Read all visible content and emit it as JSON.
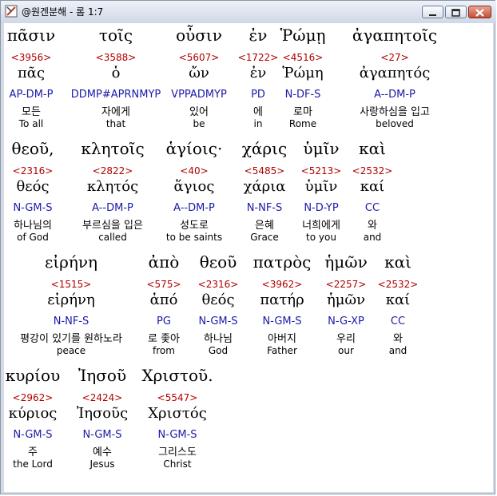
{
  "window": {
    "title": "@원겐분해 - 롬 1:7"
  },
  "rows": [
    [
      {
        "greek": "πᾶσιν",
        "num": "<3956>",
        "lemma": "πᾶς",
        "parse": "AP-DM-P",
        "kor": "모든",
        "eng": "To all"
      },
      {
        "greek": "τοῖς",
        "num": "<3588>",
        "lemma": "ὁ",
        "parse": "DDMP#APRNMYP",
        "kor": "자에게",
        "eng": "that"
      },
      {
        "greek": "οὖσιν",
        "num": "<5607>",
        "lemma": "ὤν",
        "parse": "VPPADMYP",
        "kor": "있어",
        "eng": "be"
      },
      {
        "greek": "ἐν",
        "num": "<1722>",
        "lemma": "ἐν",
        "parse": "PD",
        "kor": "에",
        "eng": "in"
      },
      {
        "greek": "Ῥώμῃ",
        "num": "<4516>",
        "lemma": "Ῥώμη",
        "parse": "N-DF-S",
        "kor": "로마",
        "eng": "Rome"
      },
      {
        "greek": "ἀγαπητοῖς",
        "num": "<27>",
        "lemma": "ἀγαπητός",
        "parse": "A--DM-P",
        "kor": "사랑하심을 입고",
        "eng": "beloved"
      }
    ],
    [
      {
        "greek": "θεοῦ,",
        "num": "<2316>",
        "lemma": "θεός",
        "parse": "N-GM-S",
        "kor": "하나님의",
        "eng": "of God"
      },
      {
        "greek": "κλητοῖς",
        "num": "<2822>",
        "lemma": "κλητός",
        "parse": "A--DM-P",
        "kor": "부르심을 입은",
        "eng": "called"
      },
      {
        "greek": "ἁγίοις·",
        "num": "<40>",
        "lemma": "ἅγιος",
        "parse": "A--DM-P",
        "kor": "성도로",
        "eng": "to be saints"
      },
      {
        "greek": "χάρις",
        "num": "<5485>",
        "lemma": "χάρια",
        "parse": "N-NF-S",
        "kor": "은혜",
        "eng": "Grace"
      },
      {
        "greek": "ὑμῖν",
        "num": "<5213>",
        "lemma": "ὑμῖν",
        "parse": "N-D-YP",
        "kor": "너희에게",
        "eng": "to you"
      },
      {
        "greek": "καὶ",
        "num": "<2532>",
        "lemma": "καί",
        "parse": "CC",
        "kor": "와",
        "eng": "and"
      }
    ],
    [
      {
        "greek": "εἰρήνη",
        "num": "<1515>",
        "lemma": "εἰρήνη",
        "parse": "N-NF-S",
        "kor": "평강이 있기를 원하노라",
        "eng": "peace"
      },
      {
        "greek": "ἀπὸ",
        "num": "<575>",
        "lemma": "ἀπό",
        "parse": "PG",
        "kor": "로 좇아",
        "eng": "from"
      },
      {
        "greek": "θεοῦ",
        "num": "<2316>",
        "lemma": "θεός",
        "parse": "N-GM-S",
        "kor": "하나님",
        "eng": "God"
      },
      {
        "greek": "πατρὸς",
        "num": "<3962>",
        "lemma": "πατήρ",
        "parse": "N-GM-S",
        "kor": "아버지",
        "eng": "Father"
      },
      {
        "greek": "ἡμῶν",
        "num": "<2257>",
        "lemma": "ἡμῶν",
        "parse": "N-G-XP",
        "kor": "우리",
        "eng": "our"
      },
      {
        "greek": "καὶ",
        "num": "<2532>",
        "lemma": "καί",
        "parse": "CC",
        "kor": "와",
        "eng": "and"
      }
    ],
    [
      {
        "greek": "κυρίου",
        "num": "<2962>",
        "lemma": "κύριος",
        "parse": "N-GM-S",
        "kor": "주",
        "eng": "the Lord"
      },
      {
        "greek": "Ἰησοῦ",
        "num": "<2424>",
        "lemma": "Ἰησοῦς",
        "parse": "N-GM-S",
        "kor": "예수",
        "eng": "Jesus"
      },
      {
        "greek": "Χριστοῦ.",
        "num": "<5547>",
        "lemma": "Χριστός",
        "parse": "N-GM-S",
        "kor": "그리스도",
        "eng": "Christ"
      }
    ]
  ]
}
